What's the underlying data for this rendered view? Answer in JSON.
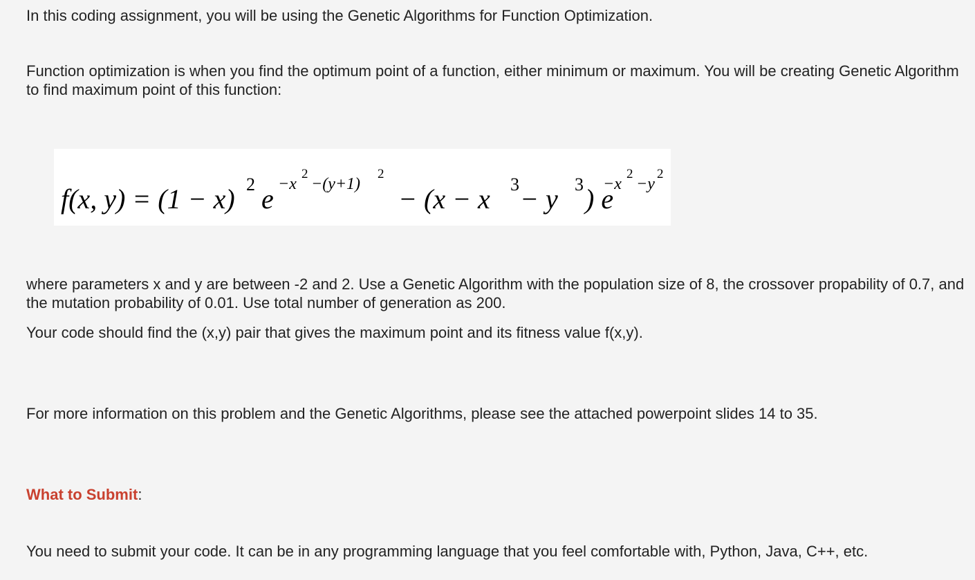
{
  "intro": "In this coding assignment, you will be using the Genetic Algorithms for Function Optimization.",
  "definition": "Function optimization is when you find the optimum point of a function, either minimum or maximum. You will be creating Genetic Algorithm to find maximum point of this function:",
  "formula": {
    "lhs": "f(x, y) = (1 − x)",
    "sq1": "2",
    "e1": "e",
    "exp1_part1": "−x",
    "exp1_sq": "2",
    "exp1_part2": "−(y+1)",
    "exp1_sq2": "2",
    "mid": "− (x − x",
    "cube1": "3",
    "mid2": " − y",
    "cube2": "3",
    "close": ") e",
    "exp2_part1": "−x",
    "exp2_sq": "2",
    "exp2_part2": "−y",
    "exp2_sq2": "2"
  },
  "parameters": "where parameters x and y are between -2 and 2. Use a Genetic Algorithm with the population size of 8, the crossover propability of 0.7, and the mutation probability of 0.01. Use total number of generation as 200.",
  "goal": "Your code should find the (x,y) pair that gives the maximum point and its fitness value f(x,y).",
  "more_info": "For more information on this problem and the Genetic Algorithms, please see the attached powerpoint slides 14 to 35.",
  "submit_heading": "What to Submit",
  "submit_colon": ":",
  "submit_text": "You need to submit your code. It can be in any programming language that you feel comfortable with, Python, Java, C++, etc.",
  "colors": {
    "heading_accent": "#c9412f",
    "background": "#f4f4f4",
    "text": "#222222"
  }
}
